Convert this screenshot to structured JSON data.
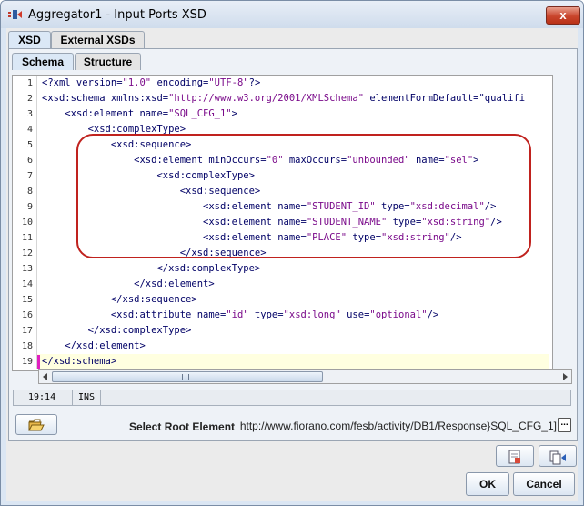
{
  "window": {
    "title": "Aggregator1 - Input Ports XSD",
    "close_symbol": "x"
  },
  "outer_tabs": [
    {
      "label": "XSD",
      "active": true
    },
    {
      "label": "External XSDs",
      "active": false
    }
  ],
  "inner_tabs": [
    {
      "label": "Schema",
      "active": true
    },
    {
      "label": "Structure",
      "active": false
    }
  ],
  "editor": {
    "line_numbers": [
      "1",
      "2",
      "3",
      "4",
      "5",
      "6",
      "7",
      "8",
      "9",
      "10",
      "11",
      "12",
      "13",
      "14",
      "15",
      "16",
      "17",
      "18",
      "19"
    ],
    "lines": [
      "<?xml version=\"1.0\" encoding=\"UTF-8\"?>",
      "<xsd:schema xmlns:xsd=\"http://www.w3.org/2001/XMLSchema\" elementFormDefault=\"qualifi",
      "    <xsd:element name=\"SQL_CFG_1\">",
      "        <xsd:complexType>",
      "            <xsd:sequence>",
      "                <xsd:element minOccurs=\"0\" maxOccurs=\"unbounded\" name=\"sel\">",
      "                    <xsd:complexType>",
      "                        <xsd:sequence>",
      "                            <xsd:element name=\"STUDENT_ID\" type=\"xsd:decimal\"/>",
      "                            <xsd:element name=\"STUDENT_NAME\" type=\"xsd:string\"/>",
      "                            <xsd:element name=\"PLACE\" type=\"xsd:string\"/>",
      "                        </xsd:sequence>",
      "                    </xsd:complexType>",
      "                </xsd:element>",
      "            </xsd:sequence>",
      "            <xsd:attribute name=\"id\" type=\"xsd:long\" use=\"optional\"/>",
      "        </xsd:complexType>",
      "    </xsd:element>",
      "</xsd:schema>"
    ],
    "current_line": 19
  },
  "status_bar": {
    "position": "19:14",
    "mode": "INS"
  },
  "root_element": {
    "label": "Select Root Element",
    "value": "http://www.fiorano.com/fesb/activity/DB1/Response}SQL_CFG_1]",
    "browse_label": "..."
  },
  "buttons": {
    "ok": "OK",
    "cancel": "Cancel"
  },
  "colors": {
    "highlight_box": "#c0221e",
    "tag": "#000066",
    "attribute": "#7a4f00",
    "value": "#7a0a8a"
  }
}
